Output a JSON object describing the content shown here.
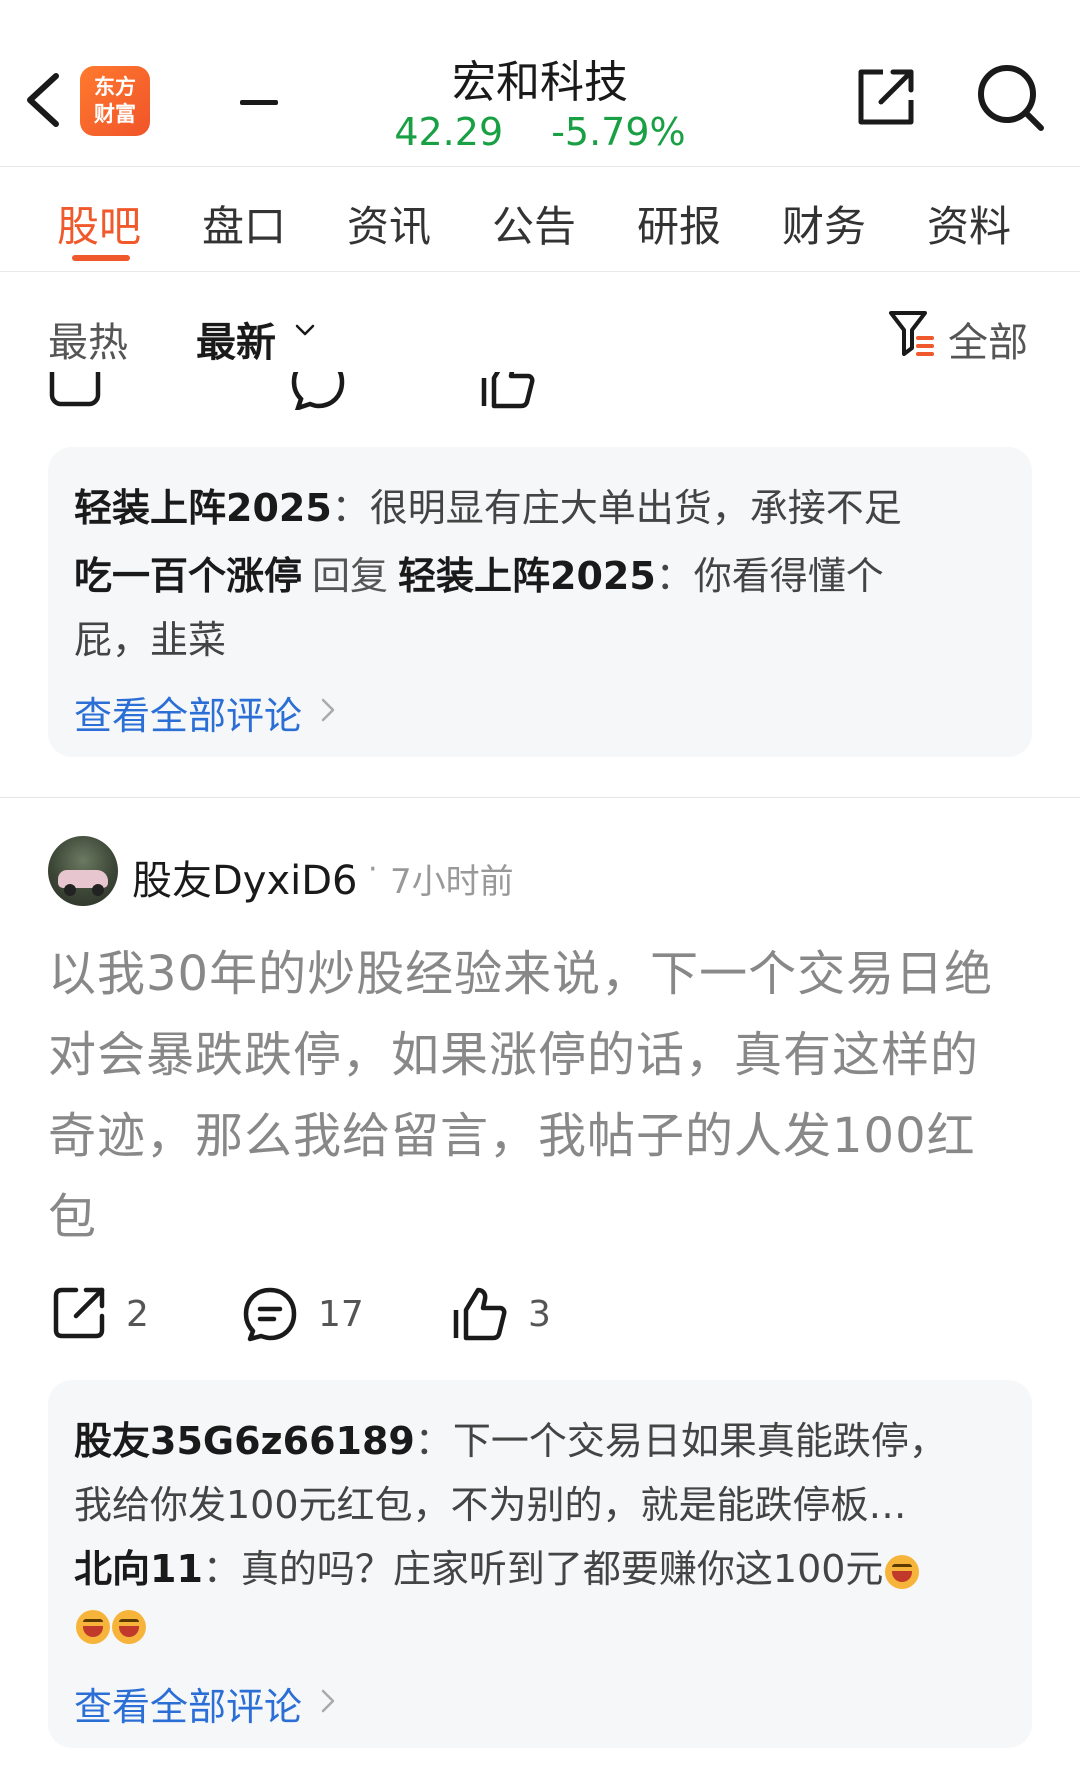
{
  "header": {
    "logo_line1": "东方",
    "logo_line2": "财富",
    "stock_name": "宏和科技",
    "price": "42.29",
    "change_pct": "-5.79%"
  },
  "tabs": [
    "股吧",
    "盘口",
    "资讯",
    "公告",
    "研报",
    "财务",
    "资料"
  ],
  "sort": {
    "hot": "最热",
    "latest": "最新",
    "filter_label": "全部"
  },
  "comment_box_1": {
    "line1_user": "轻装上阵2025",
    "line1_text": "：很明显有庄大单出货，承接不足",
    "line2_user": "吃一百个涨停",
    "line2_reply": "回复",
    "line2_target": "轻装上阵2025",
    "line2_text": "：你看得懂个",
    "line3_text": "屁，韭菜",
    "view_all": "查看全部评论"
  },
  "post": {
    "username": "股友DyxiD6",
    "dot": "·",
    "time": "7小时前",
    "lines": [
      "以我30年的炒股经验来说，下一个交易日绝",
      "对会暴跌跌停，如果涨停的话，真有这样的",
      "奇迹，那么我给留言，我帖子的人发100红",
      "包"
    ],
    "share_count": "2",
    "comment_count": "17",
    "like_count": "3"
  },
  "comment_box_2": {
    "line1_user": "股友35G6z66189",
    "line1_text": "：下一个交易日如果真能跌停，",
    "line2_text": "我给你发100元红包，不为别的，就是能跌停板…",
    "line3_user": "北向11",
    "line3_text": "：真的吗？庄家听到了都要赚你这100元",
    "view_all": "查看全部评论"
  },
  "colors": {
    "accent": "#f0592b",
    "down_green": "#1aa044",
    "link_blue": "#2b6fd6",
    "box_bg": "#f6f7f9"
  }
}
